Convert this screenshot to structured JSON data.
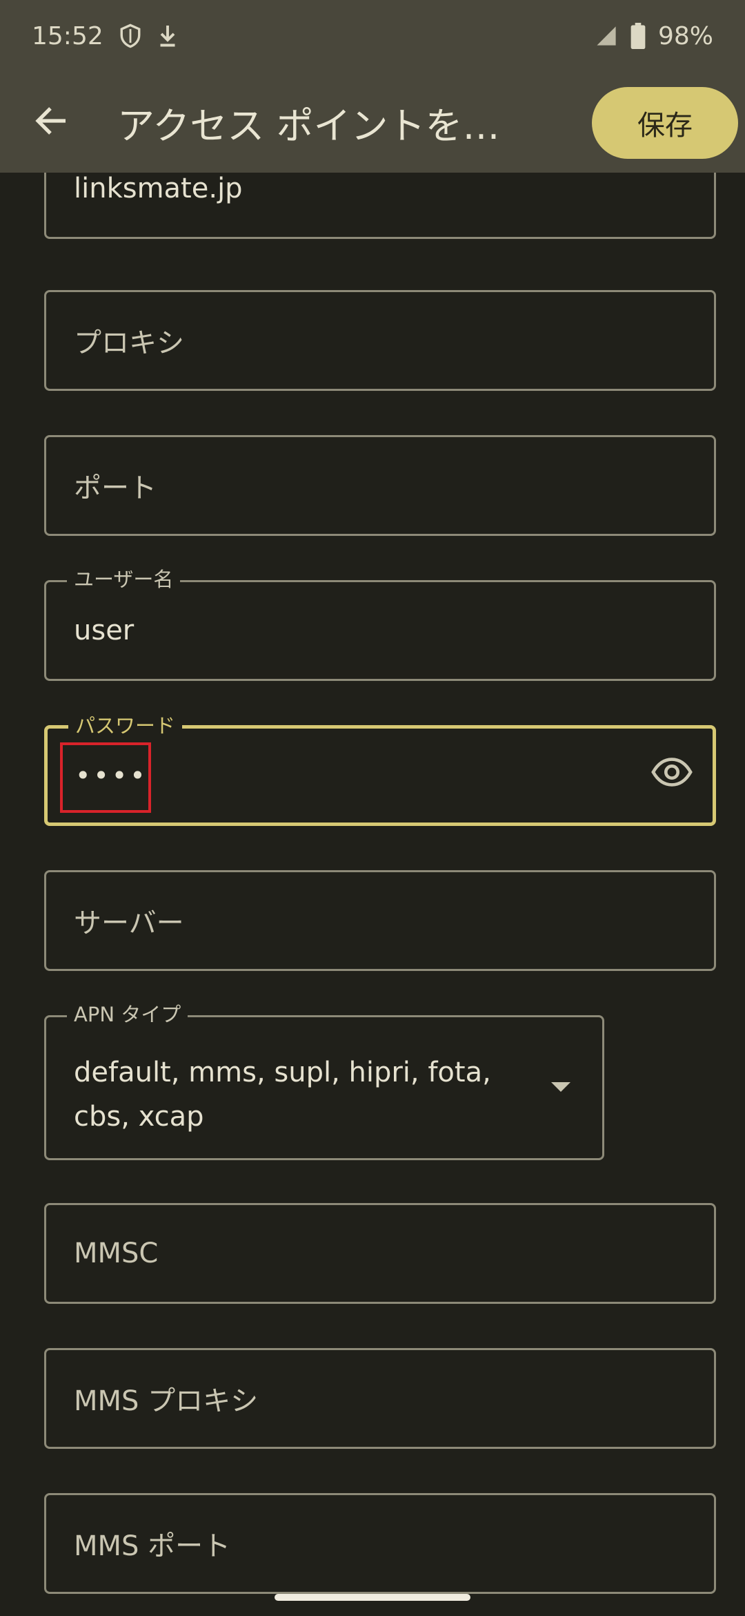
{
  "status": {
    "time": "15:52",
    "battery": "98%"
  },
  "appbar": {
    "title": "アクセス ポイントを…",
    "save_label": "保存"
  },
  "fields": {
    "apn_value": "linksmate.jp",
    "proxy_placeholder": "プロキシ",
    "port_placeholder": "ポート",
    "username_label": "ユーザー名",
    "username_value": "user",
    "password_label": "パスワード",
    "password_value": "••••",
    "server_placeholder": "サーバー",
    "apn_type_label": "APN タイプ",
    "apn_type_value": "default, mms, supl, hipri, fota, cbs, xcap",
    "mmsc_placeholder": "MMSC",
    "mms_proxy_placeholder": "MMS プロキシ",
    "mms_port_placeholder": "MMS ポート"
  },
  "colors": {
    "accent": "#d6c873",
    "surface": "#20201a",
    "appbar": "#49473b",
    "highlight": "#d8232a"
  }
}
